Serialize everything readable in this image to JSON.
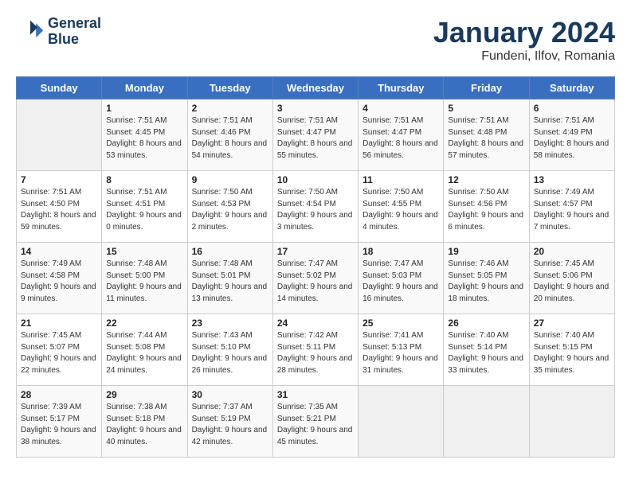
{
  "logo": {
    "text_line1": "General",
    "text_line2": "Blue"
  },
  "header": {
    "month": "January 2024",
    "location": "Fundeni, Ilfov, Romania"
  },
  "columns": [
    "Sunday",
    "Monday",
    "Tuesday",
    "Wednesday",
    "Thursday",
    "Friday",
    "Saturday"
  ],
  "weeks": [
    [
      {
        "day": "",
        "sunrise": "",
        "sunset": "",
        "daylight": ""
      },
      {
        "day": "1",
        "sunrise": "7:51 AM",
        "sunset": "4:45 PM",
        "daylight": "8 hours and 53 minutes."
      },
      {
        "day": "2",
        "sunrise": "7:51 AM",
        "sunset": "4:46 PM",
        "daylight": "8 hours and 54 minutes."
      },
      {
        "day": "3",
        "sunrise": "7:51 AM",
        "sunset": "4:47 PM",
        "daylight": "8 hours and 55 minutes."
      },
      {
        "day": "4",
        "sunrise": "7:51 AM",
        "sunset": "4:47 PM",
        "daylight": "8 hours and 56 minutes."
      },
      {
        "day": "5",
        "sunrise": "7:51 AM",
        "sunset": "4:48 PM",
        "daylight": "8 hours and 57 minutes."
      },
      {
        "day": "6",
        "sunrise": "7:51 AM",
        "sunset": "4:49 PM",
        "daylight": "8 hours and 58 minutes."
      }
    ],
    [
      {
        "day": "7",
        "sunrise": "7:51 AM",
        "sunset": "4:50 PM",
        "daylight": "8 hours and 59 minutes."
      },
      {
        "day": "8",
        "sunrise": "7:51 AM",
        "sunset": "4:51 PM",
        "daylight": "9 hours and 0 minutes."
      },
      {
        "day": "9",
        "sunrise": "7:50 AM",
        "sunset": "4:53 PM",
        "daylight": "9 hours and 2 minutes."
      },
      {
        "day": "10",
        "sunrise": "7:50 AM",
        "sunset": "4:54 PM",
        "daylight": "9 hours and 3 minutes."
      },
      {
        "day": "11",
        "sunrise": "7:50 AM",
        "sunset": "4:55 PM",
        "daylight": "9 hours and 4 minutes."
      },
      {
        "day": "12",
        "sunrise": "7:50 AM",
        "sunset": "4:56 PM",
        "daylight": "9 hours and 6 minutes."
      },
      {
        "day": "13",
        "sunrise": "7:49 AM",
        "sunset": "4:57 PM",
        "daylight": "9 hours and 7 minutes."
      }
    ],
    [
      {
        "day": "14",
        "sunrise": "7:49 AM",
        "sunset": "4:58 PM",
        "daylight": "9 hours and 9 minutes."
      },
      {
        "day": "15",
        "sunrise": "7:48 AM",
        "sunset": "5:00 PM",
        "daylight": "9 hours and 11 minutes."
      },
      {
        "day": "16",
        "sunrise": "7:48 AM",
        "sunset": "5:01 PM",
        "daylight": "9 hours and 13 minutes."
      },
      {
        "day": "17",
        "sunrise": "7:47 AM",
        "sunset": "5:02 PM",
        "daylight": "9 hours and 14 minutes."
      },
      {
        "day": "18",
        "sunrise": "7:47 AM",
        "sunset": "5:03 PM",
        "daylight": "9 hours and 16 minutes."
      },
      {
        "day": "19",
        "sunrise": "7:46 AM",
        "sunset": "5:05 PM",
        "daylight": "9 hours and 18 minutes."
      },
      {
        "day": "20",
        "sunrise": "7:45 AM",
        "sunset": "5:06 PM",
        "daylight": "9 hours and 20 minutes."
      }
    ],
    [
      {
        "day": "21",
        "sunrise": "7:45 AM",
        "sunset": "5:07 PM",
        "daylight": "9 hours and 22 minutes."
      },
      {
        "day": "22",
        "sunrise": "7:44 AM",
        "sunset": "5:08 PM",
        "daylight": "9 hours and 24 minutes."
      },
      {
        "day": "23",
        "sunrise": "7:43 AM",
        "sunset": "5:10 PM",
        "daylight": "9 hours and 26 minutes."
      },
      {
        "day": "24",
        "sunrise": "7:42 AM",
        "sunset": "5:11 PM",
        "daylight": "9 hours and 28 minutes."
      },
      {
        "day": "25",
        "sunrise": "7:41 AM",
        "sunset": "5:13 PM",
        "daylight": "9 hours and 31 minutes."
      },
      {
        "day": "26",
        "sunrise": "7:40 AM",
        "sunset": "5:14 PM",
        "daylight": "9 hours and 33 minutes."
      },
      {
        "day": "27",
        "sunrise": "7:40 AM",
        "sunset": "5:15 PM",
        "daylight": "9 hours and 35 minutes."
      }
    ],
    [
      {
        "day": "28",
        "sunrise": "7:39 AM",
        "sunset": "5:17 PM",
        "daylight": "9 hours and 38 minutes."
      },
      {
        "day": "29",
        "sunrise": "7:38 AM",
        "sunset": "5:18 PM",
        "daylight": "9 hours and 40 minutes."
      },
      {
        "day": "30",
        "sunrise": "7:37 AM",
        "sunset": "5:19 PM",
        "daylight": "9 hours and 42 minutes."
      },
      {
        "day": "31",
        "sunrise": "7:35 AM",
        "sunset": "5:21 PM",
        "daylight": "9 hours and 45 minutes."
      },
      {
        "day": "",
        "sunrise": "",
        "sunset": "",
        "daylight": ""
      },
      {
        "day": "",
        "sunrise": "",
        "sunset": "",
        "daylight": ""
      },
      {
        "day": "",
        "sunrise": "",
        "sunset": "",
        "daylight": ""
      }
    ]
  ]
}
